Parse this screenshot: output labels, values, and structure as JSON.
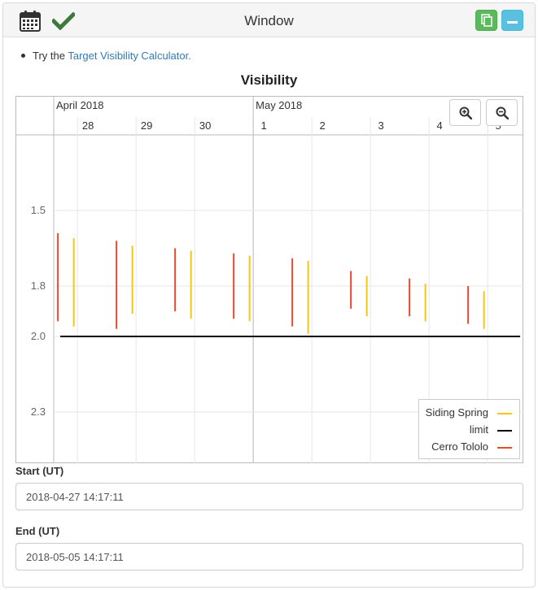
{
  "window": {
    "title": "Window",
    "icons": [
      "calendar-icon",
      "checkmark-icon",
      "copy-icon",
      "minimize-icon"
    ],
    "colors": {
      "check": "#3c7a3a",
      "copy_button": "#5cb85c",
      "minimize_button": "#5bc0de"
    }
  },
  "tip": {
    "prefix": "Try the ",
    "link_text": "Target Visibility Calculator."
  },
  "chart": {
    "title": "Visibility",
    "zoom_in_icon": "zoom-in-icon",
    "zoom_out_icon": "zoom-out-icon",
    "legend": {
      "siding_spring": "Siding Spring",
      "limit": "limit",
      "cerro_tololo": "Cerro Tololo"
    }
  },
  "chart_data": {
    "type": "line",
    "title": "Visibility",
    "xlabel": "",
    "ylabel": "",
    "x_axis": {
      "kind": "time",
      "range": [
        "2018-04-27T14:17:11",
        "2018-05-05T14:17:11"
      ],
      "month_labels": [
        {
          "date": "2018-04-27T14:17:11",
          "label": "April 2018"
        },
        {
          "date": "2018-05-01T00:00:00",
          "label": "May 2018"
        }
      ],
      "day_ticks": [
        {
          "date": "2018-04-28",
          "label": "28"
        },
        {
          "date": "2018-04-29",
          "label": "29"
        },
        {
          "date": "2018-04-30",
          "label": "30"
        },
        {
          "date": "2018-05-01",
          "label": "1"
        },
        {
          "date": "2018-05-02",
          "label": "2"
        },
        {
          "date": "2018-05-03",
          "label": "3"
        },
        {
          "date": "2018-05-04",
          "label": "4"
        },
        {
          "date": "2018-05-05",
          "label": "5"
        }
      ]
    },
    "y_axis": {
      "reversed": true,
      "range": [
        1.2,
        2.5
      ],
      "ticks": [
        1.5,
        1.8,
        2.0,
        2.3
      ],
      "tick_labels": [
        "1.5",
        "1.8",
        "2.0",
        "2.3"
      ]
    },
    "grid": true,
    "legend_position": "bottom-right",
    "series": [
      {
        "name": "Siding Spring",
        "color": "#f5c518",
        "segments": [
          {
            "x": "2018-04-27T22:30",
            "y_min": 1.61,
            "y_max": 1.96
          },
          {
            "x": "2018-04-28T22:30",
            "y_min": 1.64,
            "y_max": 1.91
          },
          {
            "x": "2018-04-29T22:30",
            "y_min": 1.66,
            "y_max": 1.93
          },
          {
            "x": "2018-04-30T22:30",
            "y_min": 1.68,
            "y_max": 1.94
          },
          {
            "x": "2018-05-01T22:30",
            "y_min": 1.7,
            "y_max": 1.99
          },
          {
            "x": "2018-05-02T22:30",
            "y_min": 1.76,
            "y_max": 1.92
          },
          {
            "x": "2018-05-03T22:30",
            "y_min": 1.79,
            "y_max": 1.94
          },
          {
            "x": "2018-05-04T22:30",
            "y_min": 1.82,
            "y_max": 1.97
          }
        ]
      },
      {
        "name": "limit",
        "color": "#000000",
        "y": 2.0
      },
      {
        "name": "Cerro Tololo",
        "color": "#e84a2c",
        "segments": [
          {
            "x": "2018-04-27T16:00",
            "y_min": 1.59,
            "y_max": 1.94
          },
          {
            "x": "2018-04-28T16:00",
            "y_min": 1.62,
            "y_max": 1.97
          },
          {
            "x": "2018-04-29T16:00",
            "y_min": 1.65,
            "y_max": 1.9
          },
          {
            "x": "2018-04-30T16:00",
            "y_min": 1.67,
            "y_max": 1.93
          },
          {
            "x": "2018-05-01T16:00",
            "y_min": 1.69,
            "y_max": 1.96
          },
          {
            "x": "2018-05-02T16:00",
            "y_min": 1.74,
            "y_max": 1.89
          },
          {
            "x": "2018-05-03T16:00",
            "y_min": 1.77,
            "y_max": 1.92
          },
          {
            "x": "2018-05-04T16:00",
            "y_min": 1.8,
            "y_max": 1.95
          }
        ]
      }
    ]
  },
  "form": {
    "start_label": "Start (UT)",
    "start_value": "2018-04-27 14:17:11",
    "end_label": "End (UT)",
    "end_value": "2018-05-05 14:17:11"
  }
}
